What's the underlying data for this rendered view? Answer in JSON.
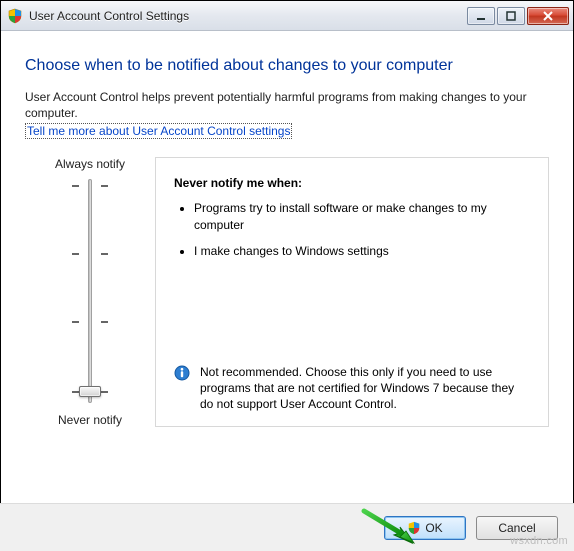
{
  "window": {
    "title": "User Account Control Settings"
  },
  "heading": "Choose when to be notified about changes to your computer",
  "intro": "User Account Control helps prevent potentially harmful programs from making changes to your computer.",
  "link": "Tell me more about User Account Control settings",
  "slider": {
    "top_label": "Always notify",
    "bottom_label": "Never notify",
    "position": 3,
    "levels": 4
  },
  "panel": {
    "title": "Never notify me when:",
    "bullets": [
      "Programs try to install software or make changes to my computer",
      "I make changes to Windows settings"
    ],
    "recommendation": "Not recommended. Choose this only if you need to use programs that are not certified for Windows 7 because they do not support User Account Control."
  },
  "buttons": {
    "ok": "OK",
    "cancel": "Cancel"
  },
  "watermark": "wsxdn.com"
}
